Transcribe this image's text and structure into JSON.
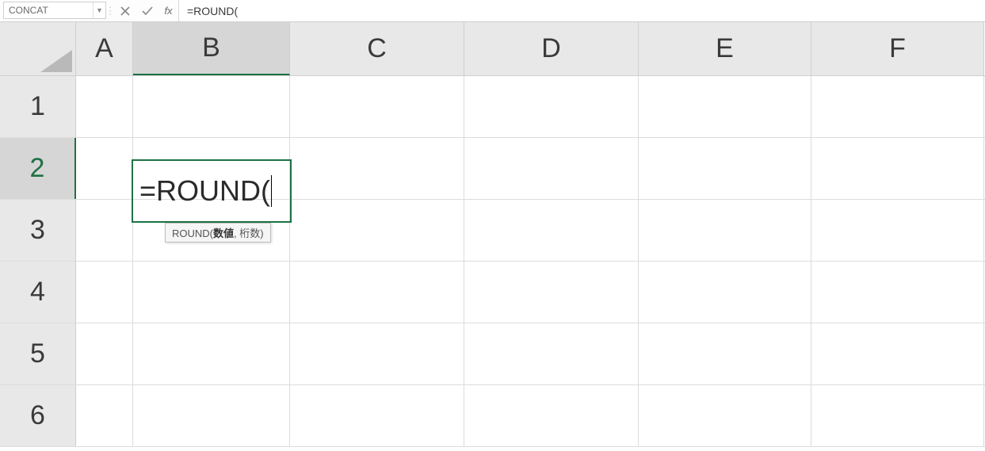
{
  "formulaBar": {
    "nameBoxValue": "CONCAT",
    "cancelTooltip": "Cancel",
    "enterTooltip": "Enter",
    "fxLabel": "fx",
    "formulaText": "=ROUND("
  },
  "columns": [
    "A",
    "B",
    "C",
    "D",
    "E",
    "F"
  ],
  "rows": [
    "1",
    "2",
    "3",
    "4",
    "5",
    "6"
  ],
  "activeCell": {
    "ref": "B2",
    "displayText": "=ROUND("
  },
  "tooltip": {
    "functionName": "ROUND",
    "argHighlighted": "数値",
    "argsRest": ", 桁数",
    "close": ")"
  }
}
